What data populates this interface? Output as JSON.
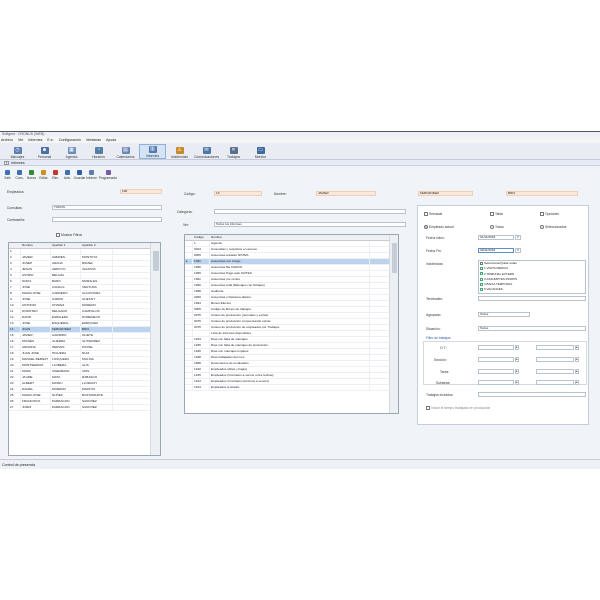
{
  "window": {
    "title": "Softgest · CRONUS (WEB)"
  },
  "menu": [
    "Archivo",
    "Ver",
    "Informes",
    "E.e.",
    "Configuración",
    "Ventanas",
    "Ayuda"
  ],
  "ribbon": [
    {
      "label": "Marcajes",
      "icon": "clock-icon",
      "color": "#5b7fb0"
    },
    {
      "label": "Personal",
      "icon": "people-icon",
      "color": "#4b6fa2"
    },
    {
      "label": "Agenda",
      "icon": "calendar-icon",
      "color": "#6a8ec0"
    },
    {
      "label": "Horarios",
      "icon": "schedule-icon",
      "color": "#577da9"
    },
    {
      "label": "Calendarios",
      "icon": "calendar-grid-icon",
      "color": "#6b88b6"
    },
    {
      "label": "Informes",
      "icon": "report-icon",
      "color": "#5378ae"
    },
    {
      "label": "Incidencias",
      "icon": "warning-icon",
      "color": "#c78a2a"
    },
    {
      "label": "Comunicaciones",
      "icon": "comm-icon",
      "color": "#4f78a8"
    },
    {
      "label": "Trabajos",
      "icon": "tools-icon",
      "color": "#5a6f8c"
    },
    {
      "label": "Monitor",
      "icon": "monitor-icon",
      "color": "#3e6aa0"
    }
  ],
  "panel": {
    "title": "Informes"
  },
  "toolbar": [
    "Salir",
    "Cons.",
    "Nuevo",
    "Editar",
    "Elim.",
    "Actu.",
    "Guardar",
    "Informe",
    "Programador"
  ],
  "left": {
    "empleados_label": "Empleados:",
    "empleados_value": "100",
    "consultas_label": "Consultas:",
    "consultas_value": "TODOS",
    "contrasena_label": "Contraseña:",
    "mostrar_filtros": "Mostrar Filtros",
    "columns": [
      "",
      "Nombre",
      "Apellido 1",
      "Apellido 2"
    ],
    "rows": [
      [
        "1",
        "",
        "",
        ""
      ],
      [
        "2",
        "JAVIER",
        "ANDRES",
        "MONTOYA"
      ],
      [
        "3",
        "JOSEP",
        "ARANA",
        "RIDAEL"
      ],
      [
        "4",
        "JESUS",
        "ARROYO",
        "VALDIVIA"
      ],
      [
        "5",
        "ASTRID",
        "BELUZA",
        ""
      ],
      [
        "6",
        "SOFIA",
        "BARO",
        "MORALES"
      ],
      [
        "7",
        "JOSE",
        "CANALS",
        "VENTURA"
      ],
      [
        "8",
        "MARIA JOSE",
        "CARRERO",
        "ALCANTARA"
      ],
      [
        "9",
        "JOSE",
        "CARRO",
        "GUETAIT"
      ],
      [
        "10",
        "ANTONIO",
        "CHAVEZ",
        "MORENO"
      ],
      [
        "11",
        "DOROTEO",
        "DELGADO",
        "CAMPILLOS"
      ],
      [
        "12",
        "DAVID",
        "ESPALERA",
        "DOMENECH"
      ],
      [
        "13",
        "JOSE",
        "ESQUERAL",
        "ENRIQUEZ"
      ],
      [
        "14",
        "JOAN",
        "FERNANDEZ",
        "BRIA"
      ],
      [
        "15",
        "JAVIER",
        "GARRIDO",
        "OLIETE"
      ],
      [
        "16",
        "MOISÉS",
        "GUERRA",
        "GUTIERREZ"
      ],
      [
        "17",
        "ARIADNA",
        "HERVAS",
        "PICHEL"
      ],
      [
        "18",
        "JUAN JOSE",
        "HIGUERA",
        "RUIZ"
      ],
      [
        "19",
        "MANUEL BERNAT",
        "LOSQUERA",
        "MOLINA"
      ],
      [
        "20",
        "MONTSERRAT",
        "LLOBERA",
        "ALIS"
      ],
      [
        "21",
        "MARC",
        "OSERRANA",
        "ANIS"
      ],
      [
        "22",
        "JAUME",
        "MATA",
        "RABASCO"
      ],
      [
        "23",
        "ALBERT",
        "MATEU",
        "LLORACH"
      ],
      [
        "24",
        "DANIEL",
        "MORENO",
        "MARTOS"
      ],
      [
        "25",
        "MARIA JOSE",
        "NUÑEZ",
        "BUSTAMANTE"
      ],
      [
        "26",
        "FRANCISCO",
        "PARRAGON",
        "SANCHEZ"
      ],
      [
        "27",
        "JORDI",
        "PARRAGON",
        "SANCHEZ"
      ]
    ],
    "selected_row": 13
  },
  "center": {
    "codigo_label": "Código:",
    "codigo_value": "13",
    "nombre_label": "Nombre:",
    "nombre_value": "JAVIER",
    "apellido1_value": "FERNANDEZ",
    "apellido2_value": "BRIA",
    "categoria_label": "Categoría:",
    "ver_label": "Ver:",
    "ver_value": "Todos los informes",
    "columns": [
      "",
      "Código",
      "Nombre"
    ],
    "rows": [
      [
        "1",
        "Agenda"
      ],
      [
        "0024",
        "Anomalías y requisitos en acceso"
      ],
      [
        "0005",
        "Ausencias anuales NOTES"
      ],
      [
        "1991",
        "Ausencias con Cargo"
      ],
      [
        "1996",
        "Ausencias fila CARGO"
      ],
      [
        "1999",
        "Ausencias Pago auto NOTES"
      ],
      [
        "1991",
        "Ausencias por centro"
      ],
      [
        "1996",
        "Ausencias total (Marcajes con fichajes)"
      ],
      [
        "1998",
        "Auditoría"
      ],
      [
        "2000",
        "Ausencias y Retrasos diarios"
      ],
      [
        "1994",
        "Bonos Efectos"
      ],
      [
        "0005",
        "Código de Bonos de trabajos"
      ],
      [
        "0075",
        "Costes de producción (normales y extras)"
      ],
      [
        "0076",
        "Costes de producción compensando extras"
      ],
      [
        "0076",
        "Costes de producción de empleados por Trabajos"
      ],
      [
        "",
        "Lista de informes disponibles"
      ],
      [
        "1944",
        "Días con falta de marcajes"
      ],
      [
        "1945",
        "Días con falta de marcajes de producción"
      ],
      [
        "1946",
        "Días con marcajes impares"
      ],
      [
        "1948",
        "Días trabajados del mes"
      ],
      [
        "1898",
        "Documentos de empleados"
      ],
      [
        "1910",
        "Empleados (Altas y bajas)"
      ],
      [
        "1915",
        "Empleados (Contratos a vencer entre fechas)"
      ],
      [
        "1913",
        "Empleados (Contratos próximos a vencer)"
      ],
      [
        "1914",
        "Empleados (Listado)"
      ]
    ],
    "selected_row": 3
  },
  "right": {
    "semanal": "Semanal",
    "tabla": "Tabla",
    "opciones": "Opciones",
    "emp_actual": "Empleado actual",
    "todos": "Todos",
    "seleccionados": "Seleccionados",
    "fecha_inicio_label": "Fecha Inicio:",
    "fecha_inicio_value": "01/11/2018",
    "fecha_fin_label": "Fecha Fin:",
    "fecha_fin_value": "30/11/2018",
    "incidencias_label": "Incidencias:",
    "incidencias": [
      "Seleccionar/Quitar todas",
      "1 VISITA MEDICA",
      "2 TRIBUNAL EXTERN",
      "3 ASSUMPTES PROPIS",
      "4 BAIXA TEMPORAL",
      "5 VACANCES"
    ],
    "terminales_label": "Terminales:",
    "agrupado_label": "Agrupado:",
    "agrupado_value": "Todos",
    "situacion_label": "Situación:",
    "situacion_value": "Todos",
    "filtro_label": "Filtro de trabajos",
    "ot_label": "O.T.:",
    "seccion_label": "Sección:",
    "tarea_label": "Tarea:",
    "subtarea_label": "Subtarea:",
    "trabajos_label": "Trabajos incluidos:",
    "bottom_check": "Incluir el tiempo trabajado en producción"
  },
  "status": {
    "text": "Control de presencia"
  }
}
